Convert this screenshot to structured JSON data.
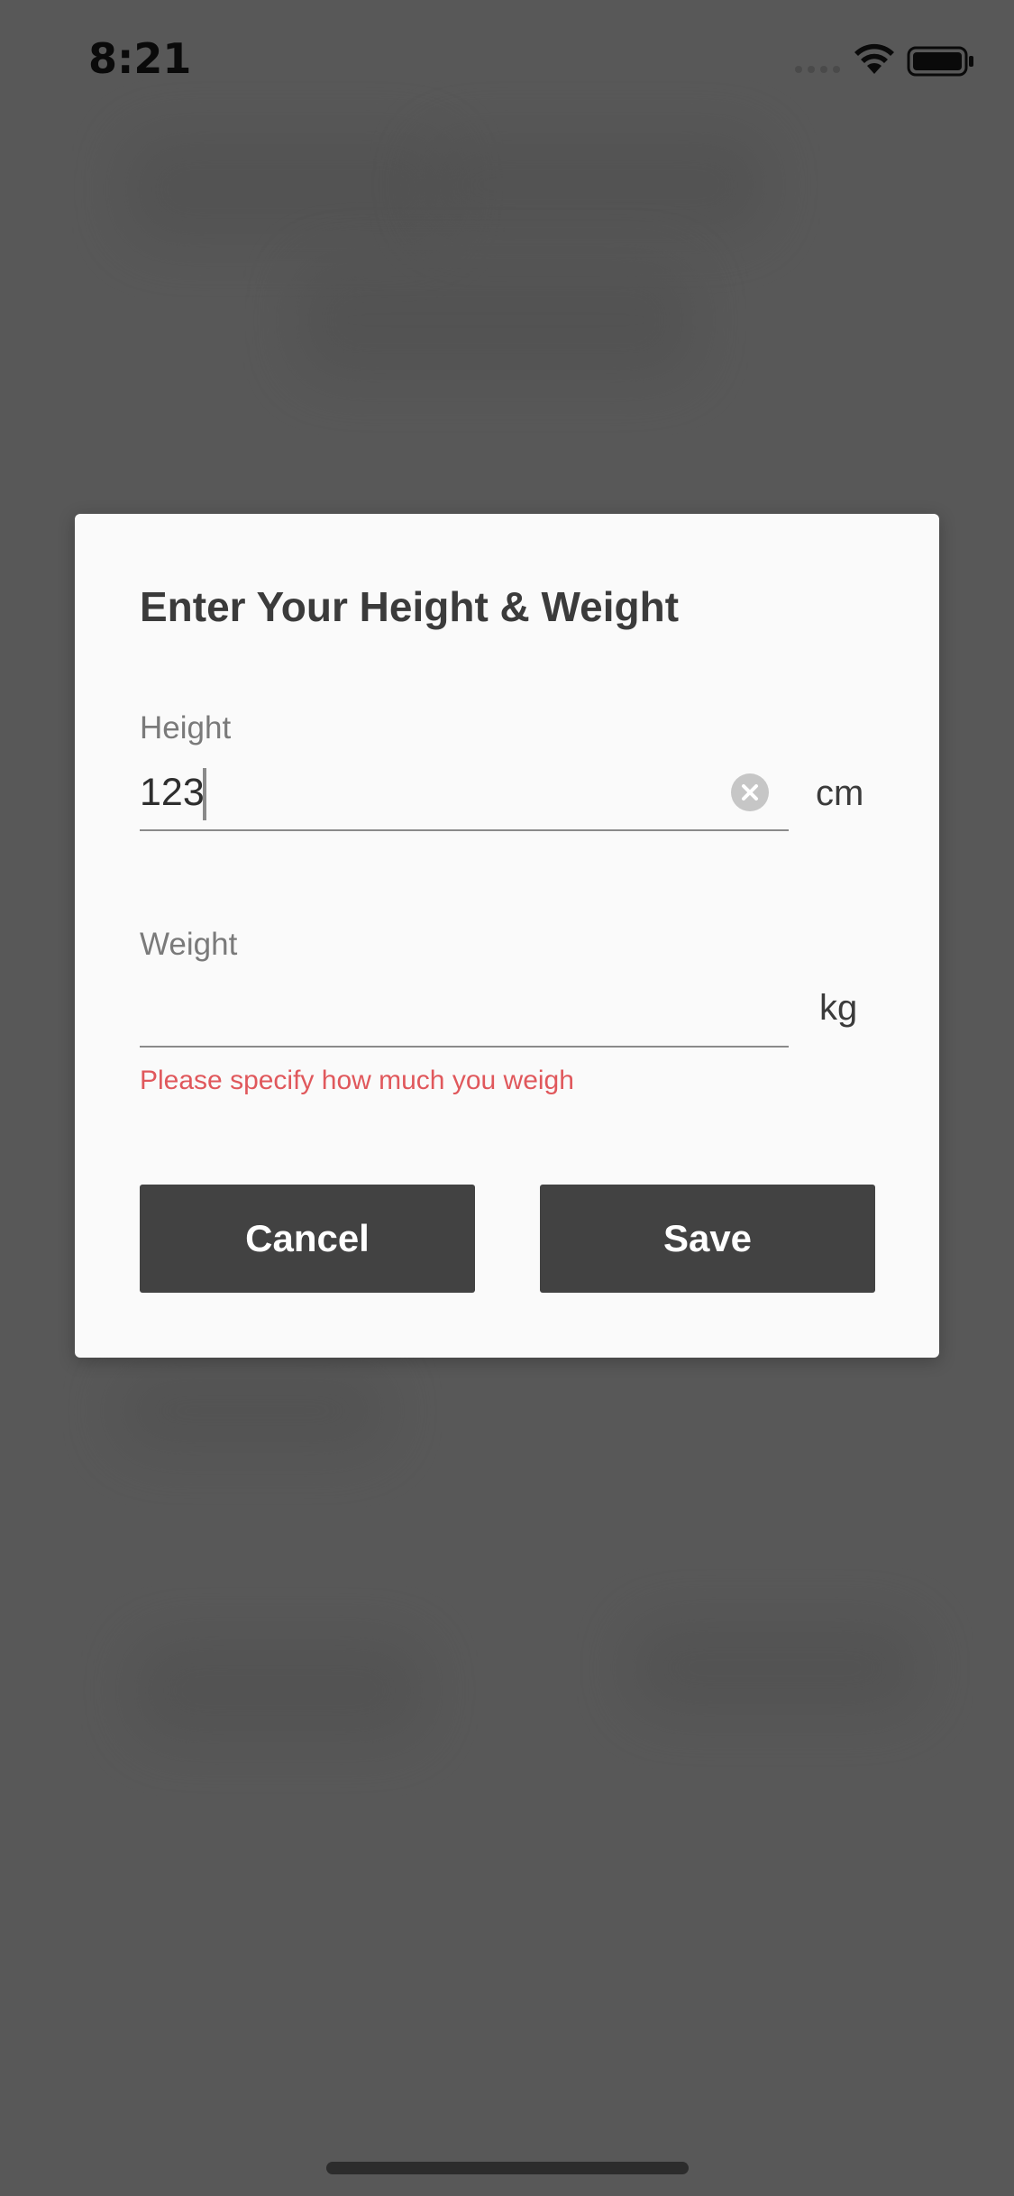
{
  "status_bar": {
    "time": "8:21"
  },
  "dialog": {
    "title": "Enter Your Height & Weight",
    "height_field": {
      "label": "Height",
      "value": "123",
      "unit": "cm"
    },
    "weight_field": {
      "label": "Weight",
      "value": "",
      "unit": "kg",
      "error": "Please specify how much you weigh"
    },
    "buttons": {
      "cancel_label": "Cancel",
      "save_label": "Save"
    }
  },
  "colors": {
    "overlay": "#585858",
    "dialog_bg": "#fafafa",
    "button_bg": "#424242",
    "error": "#e0585c"
  },
  "icons": {
    "status": [
      "signal-icon",
      "wifi-icon",
      "battery-icon"
    ],
    "field": [
      "clear-icon"
    ]
  }
}
